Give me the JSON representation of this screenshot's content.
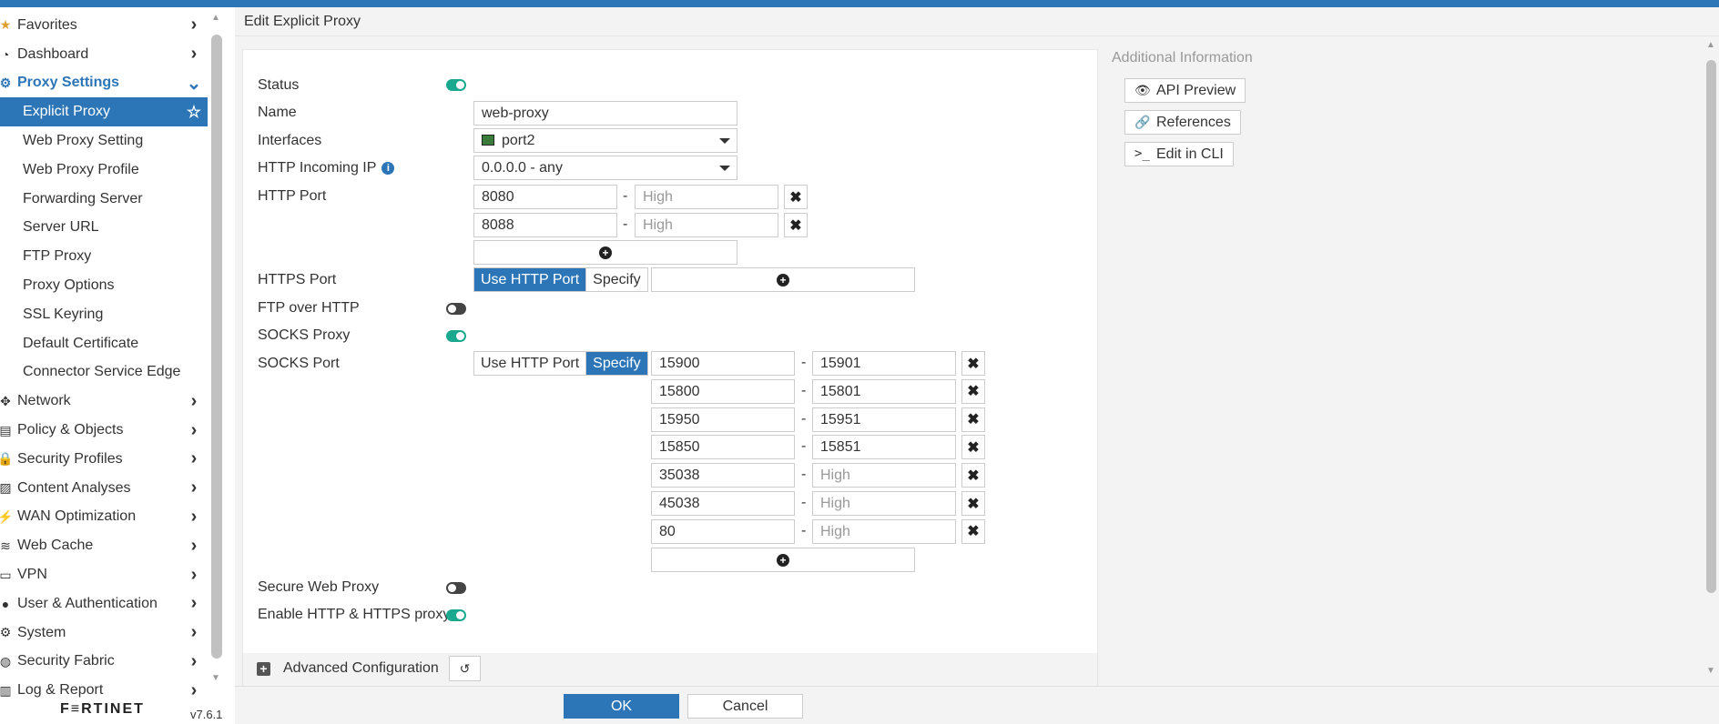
{
  "sidebar": {
    "items": [
      {
        "label": "Favorites",
        "icon": "star-icon",
        "type": "group"
      },
      {
        "label": "Dashboard",
        "icon": "dashboard-icon",
        "type": "group"
      },
      {
        "label": "Proxy Settings",
        "icon": "gear-icon",
        "type": "open"
      },
      {
        "label": "Explicit Proxy",
        "type": "active"
      },
      {
        "label": "Web Proxy Setting",
        "type": "sub"
      },
      {
        "label": "Web Proxy Profile",
        "type": "sub"
      },
      {
        "label": "Forwarding Server",
        "type": "sub"
      },
      {
        "label": "Server URL",
        "type": "sub"
      },
      {
        "label": "FTP Proxy",
        "type": "sub"
      },
      {
        "label": "Proxy Options",
        "type": "sub"
      },
      {
        "label": "SSL Keyring",
        "type": "sub"
      },
      {
        "label": "Default Certificate",
        "type": "sub"
      },
      {
        "label": "Connector Service Edge",
        "type": "sub"
      },
      {
        "label": "Network",
        "icon": "network-icon",
        "type": "group"
      },
      {
        "label": "Policy & Objects",
        "icon": "policy-icon",
        "type": "group"
      },
      {
        "label": "Security Profiles",
        "icon": "lock-icon",
        "type": "group"
      },
      {
        "label": "Content Analyses",
        "icon": "image-icon",
        "type": "group"
      },
      {
        "label": "WAN Optimization",
        "icon": "bolt-icon",
        "type": "group"
      },
      {
        "label": "Web Cache",
        "icon": "database-icon",
        "type": "group"
      },
      {
        "label": "VPN",
        "icon": "laptop-icon",
        "type": "group"
      },
      {
        "label": "User & Authentication",
        "icon": "user-icon",
        "type": "group"
      },
      {
        "label": "System",
        "icon": "gear-icon",
        "type": "group"
      },
      {
        "label": "Security Fabric",
        "icon": "fabric-icon",
        "type": "group"
      },
      {
        "label": "Log & Report",
        "icon": "chart-icon",
        "type": "group"
      }
    ],
    "brand": "F≡RTINET",
    "version": "v7.6.1"
  },
  "header": {
    "title": "Edit Explicit Proxy"
  },
  "form": {
    "status_label": "Status",
    "status": "on",
    "name_label": "Name",
    "name_value": "web-proxy",
    "interfaces_label": "Interfaces",
    "interfaces_value": "port2",
    "incoming_ip_label": "HTTP Incoming IP",
    "incoming_ip_value": "0.0.0.0 - any",
    "http_port_label": "HTTP Port",
    "http_ports": [
      {
        "low": "8080",
        "high": ""
      },
      {
        "low": "8088",
        "high": ""
      }
    ],
    "high_placeholder": "High",
    "https_port_label": "HTTPS Port",
    "use_http_port": "Use HTTP Port",
    "specify": "Specify",
    "ftp_over_http_label": "FTP over HTTP",
    "ftp_over_http": "off",
    "socks_proxy_label": "SOCKS Proxy",
    "socks_proxy": "on",
    "socks_port_label": "SOCKS Port",
    "socks_ports": [
      {
        "low": "15900",
        "high": "15901"
      },
      {
        "low": "15800",
        "high": "15801"
      },
      {
        "low": "15950",
        "high": "15951"
      },
      {
        "low": "15850",
        "high": "15851"
      },
      {
        "low": "35038",
        "high": ""
      },
      {
        "low": "45038",
        "high": ""
      },
      {
        "low": "80",
        "high": ""
      }
    ],
    "secure_web_proxy_label": "Secure Web Proxy",
    "secure_web_proxy": "off",
    "enable_http_https_label": "Enable HTTP & HTTPS proxy",
    "enable_http_https": "on",
    "advanced_label": "Advanced Configuration"
  },
  "side_panel": {
    "title": "Additional Information",
    "api_preview": "API Preview",
    "references": "References",
    "edit_in_cli": "Edit in CLI"
  },
  "footer": {
    "ok": "OK",
    "cancel": "Cancel"
  },
  "colors": {
    "accent": "#2c76b8",
    "toggle_on": "#1aa88e"
  }
}
